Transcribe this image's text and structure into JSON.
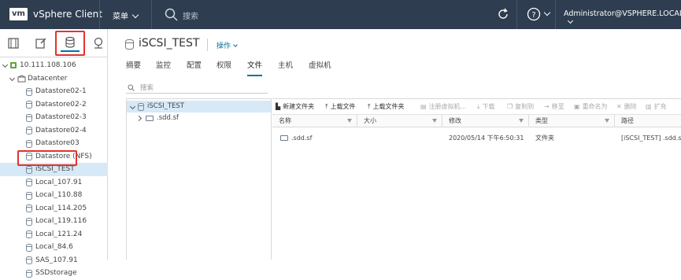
{
  "header": {
    "logo": "vm",
    "app_title": "vSphere Client",
    "menu_label": "菜单",
    "search_placeholder": "搜索",
    "user": "Administrator@VSPHERE.LOCAL"
  },
  "navigator": {
    "tabs": [
      "hosts-clusters-icon",
      "vms-templates-icon",
      "storage-icon",
      "networking-icon"
    ],
    "active_tab": "storage-icon",
    "tree": [
      {
        "label": "10.111.108.106",
        "level": 0,
        "expanded": true,
        "icon": "vcenter-icon"
      },
      {
        "label": "Datacenter",
        "level": 1,
        "expanded": true,
        "icon": "datacenter-icon"
      },
      {
        "label": "Datastore02-1",
        "level": 2,
        "icon": "datastore-icon"
      },
      {
        "label": "Datastore02-2",
        "level": 2,
        "icon": "datastore-icon"
      },
      {
        "label": "Datastore02-3",
        "level": 2,
        "icon": "datastore-icon"
      },
      {
        "label": "Datastore02-4",
        "level": 2,
        "icon": "datastore-icon"
      },
      {
        "label": "Datastore03",
        "level": 2,
        "icon": "datastore-icon"
      },
      {
        "label": "Datastore (NFS)",
        "level": 2,
        "icon": "datastore-icon"
      },
      {
        "label": "iSCSI_TEST",
        "level": 2,
        "icon": "datastore-icon",
        "selected": true
      },
      {
        "label": "Local_107.91",
        "level": 2,
        "icon": "datastore-icon"
      },
      {
        "label": "Local_110.88",
        "level": 2,
        "icon": "datastore-icon"
      },
      {
        "label": "Local_114.205",
        "level": 2,
        "icon": "datastore-icon"
      },
      {
        "label": "Local_119.116",
        "level": 2,
        "icon": "datastore-icon"
      },
      {
        "label": "Local_121.24",
        "level": 2,
        "icon": "datastore-icon"
      },
      {
        "label": "Local_84.6",
        "level": 2,
        "icon": "datastore-icon"
      },
      {
        "label": "SAS_107.91",
        "level": 2,
        "icon": "datastore-icon"
      },
      {
        "label": "SSDstorage",
        "level": 2,
        "icon": "datastore-icon"
      }
    ]
  },
  "main": {
    "title": "iSCSI_TEST",
    "actions_label": "操作",
    "tabs": [
      "摘要",
      "监控",
      "配置",
      "权限",
      "文件",
      "主机",
      "虚拟机"
    ],
    "active_tab": "文件",
    "search_placeholder": "搜索",
    "file_tree": [
      {
        "label": "iSCSI_TEST",
        "level": 0,
        "selected": true
      },
      {
        "label": ".sdd.sf",
        "level": 1
      }
    ],
    "toolbar": [
      {
        "label": "新建文件夹",
        "icon": "new-folder-icon",
        "enabled": true
      },
      {
        "label": "上载文件",
        "icon": "upload-file-icon",
        "enabled": true
      },
      {
        "label": "上载文件夹",
        "icon": "upload-folder-icon",
        "enabled": true
      },
      {
        "label": "注册虚拟机...",
        "icon": "register-vm-icon",
        "enabled": false
      },
      {
        "label": "下载",
        "icon": "download-icon",
        "enabled": false
      },
      {
        "label": "复制到",
        "icon": "copy-icon",
        "enabled": false
      },
      {
        "label": "移至",
        "icon": "move-icon",
        "enabled": false
      },
      {
        "label": "重命名为",
        "icon": "rename-icon",
        "enabled": false
      },
      {
        "label": "删除",
        "icon": "delete-icon",
        "enabled": false
      },
      {
        "label": "扩充",
        "icon": "inflate-icon",
        "enabled": false
      }
    ],
    "columns": [
      "名称",
      "大小",
      "修改",
      "类型",
      "路径"
    ],
    "rows": [
      {
        "name": ".sdd.sf",
        "size": "",
        "modified": "2020/05/14 下午6:50:31",
        "type": "文件夹",
        "path": "[iSCSI_TEST] .sdd.sf"
      }
    ]
  },
  "colors": {
    "header_bg": "#2e3d4f",
    "accent": "#0072a3",
    "highlight_box": "#e5322c",
    "selected_row": "#d7e8f6"
  }
}
